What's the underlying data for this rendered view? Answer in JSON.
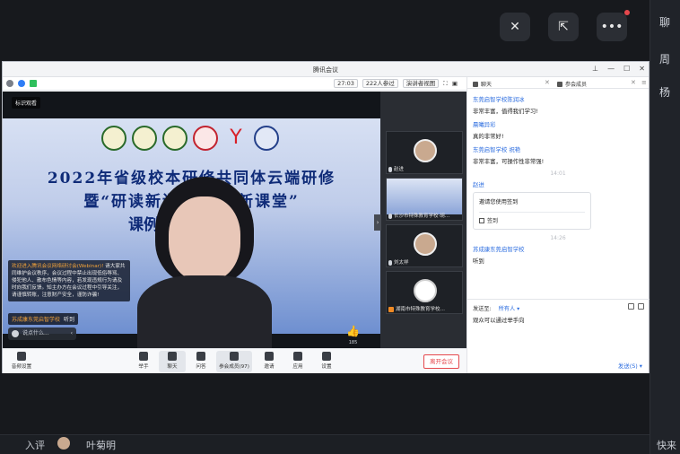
{
  "background": {
    "right_rail": [
      "聊",
      "周",
      "杨"
    ],
    "bottom_strip": {
      "left_text": "入评",
      "name": "叶菊明",
      "right_text": "快来"
    }
  },
  "window": {
    "title": "腾讯会议",
    "toolbar": {
      "duration": "27:03",
      "participants": "222人参过",
      "view_mode": "演讲者视图"
    }
  },
  "video": {
    "share_tag": "标识观看",
    "slide": {
      "title_line1": "2022年省级校本研修共同体云端研修",
      "title_line2": "暨“研读新课标 构建新课堂”",
      "title_line3": "课例展示活动"
    },
    "notice": {
      "head": "欢迎进入腾讯会议网络研讨会(Webinar)!",
      "body": "请大家共同维护会议秩序，会议过程中禁止出现低俗辱骂、侵犯他人、散布色情等内容，若发现违规行为请及时向我们反馈。知主办方在会议过程中引导关注，请谨慎转账，注意财产安全，谨防诈骗!"
    },
    "last_sender": {
      "name": "苏成康东莞启智学校",
      "text": "听到"
    },
    "say_placeholder": "说点什么...",
    "like_count": "185"
  },
  "thumbs": [
    {
      "label": "赵进"
    },
    {
      "label": "长沙市特殊教育学校·胡…"
    },
    {
      "label": "刘太祥"
    },
    {
      "label": "湖南市特殊教育学校…"
    }
  ],
  "bottom_toolbar": {
    "audio": "音频设置",
    "items": [
      "举手",
      "聊天",
      "问答",
      "参会成员(97)",
      "邀请",
      "应用",
      "设置"
    ],
    "end": "离开会议"
  },
  "side": {
    "tab_chat": "聊天",
    "tab_members": "参会成员",
    "messages": [
      {
        "name": "东莞启智学校陈润冰",
        "text": "非常丰富，值得我们学习!"
      },
      {
        "name": "晨曦异彩",
        "text": "真的非常好!"
      },
      {
        "name": "东莞启智学校 祝艳",
        "text": "非常丰富，可操作性非常强!"
      }
    ],
    "time1": "14:01",
    "sign_sender": "赵进",
    "sign_card": {
      "title": "邀请您使用签到",
      "button": "签到"
    },
    "time2": "14:26",
    "last_name": "苏成康东莞启智学校",
    "last_text": "听到",
    "compose": {
      "to_label": "发送至:",
      "to_value": "所有人",
      "draft": "观众可以通过举手向",
      "send": "发送(S)"
    }
  }
}
